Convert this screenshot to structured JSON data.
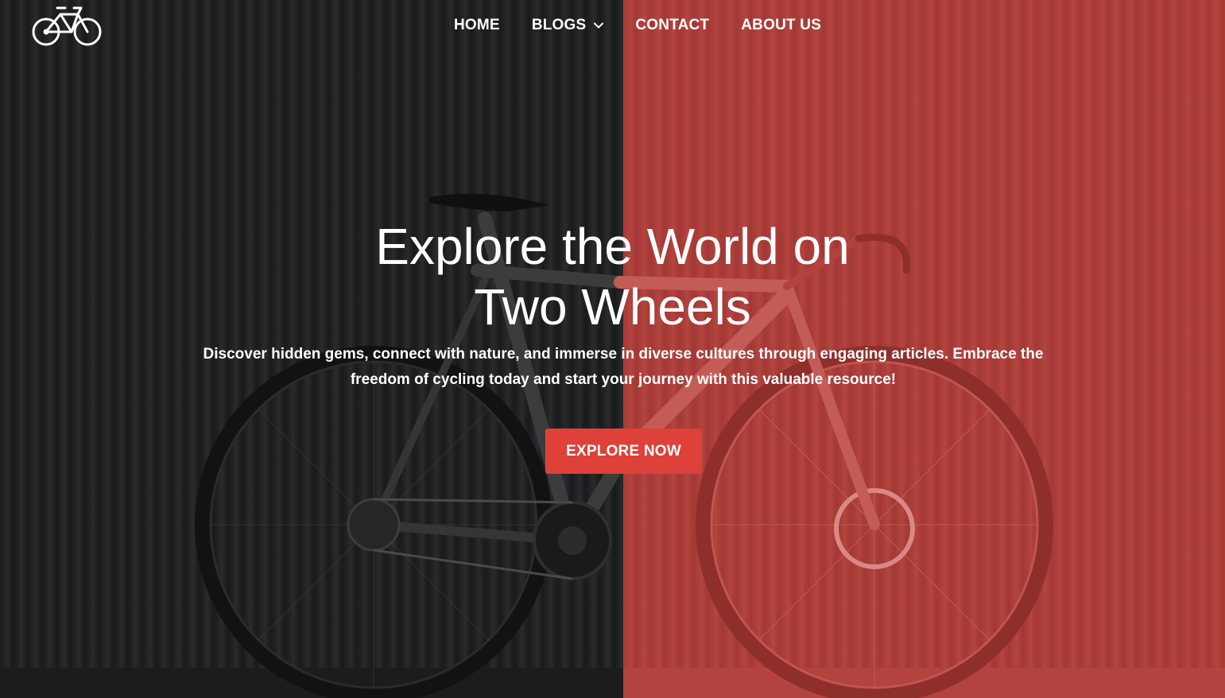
{
  "brand": {
    "logo_icon": "bicycle-icon"
  },
  "nav": {
    "items": [
      {
        "label": "HOME"
      },
      {
        "label": "BLOGS",
        "has_dropdown": true,
        "dropdown_icon": "chevron-down-icon"
      },
      {
        "label": "CONTACT"
      },
      {
        "label": "ABOUT US"
      }
    ]
  },
  "hero": {
    "headline_line1": "Explore the World on",
    "headline_line2": "Two Wheels",
    "subtext": "Discover hidden gems, connect with nature, and immerse in diverse cultures through engaging articles. Embrace the freedom of cycling today and start your journey with this valuable resource!",
    "cta_label": "EXPLORE NOW",
    "background_image": "road-bike-against-corrugated-wall"
  },
  "colors": {
    "overlay_left": "#1b1c1d",
    "overlay_right": "#ad3f3b",
    "accent": "#de403a",
    "text": "#ffffff"
  }
}
